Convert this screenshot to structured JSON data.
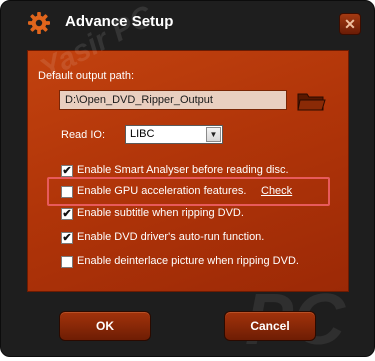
{
  "dialog": {
    "title": "Advance Setup",
    "close_symbol": "✕"
  },
  "output_path": {
    "label": "Default output path:",
    "value": "D:\\Open_DVD_Ripper_Output",
    "browse_icon": "folder-icon"
  },
  "read_io": {
    "label": "Read IO:",
    "selected": "LIBC"
  },
  "options": [
    {
      "label": "Enable Smart Analyser before reading disc.",
      "checked": true
    },
    {
      "label": "Enable GPU acceleration features.",
      "checked": false
    },
    {
      "label": "Enable subtitle when ripping DVD.",
      "checked": true
    },
    {
      "label": "Enable DVD driver's auto-run function.",
      "checked": true
    },
    {
      "label": "Enable deinterlace picture when ripping DVD.",
      "checked": false
    }
  ],
  "gpu_check_link": "Check",
  "buttons": {
    "ok": "OK",
    "cancel": "Cancel"
  },
  "watermark": {
    "text_small": "Yasir PC",
    "text_large": "PC"
  },
  "colors": {
    "panel": "#b13509",
    "window": "#1e1e1e",
    "highlight": "#e85a5c"
  },
  "check_mark": "✔"
}
